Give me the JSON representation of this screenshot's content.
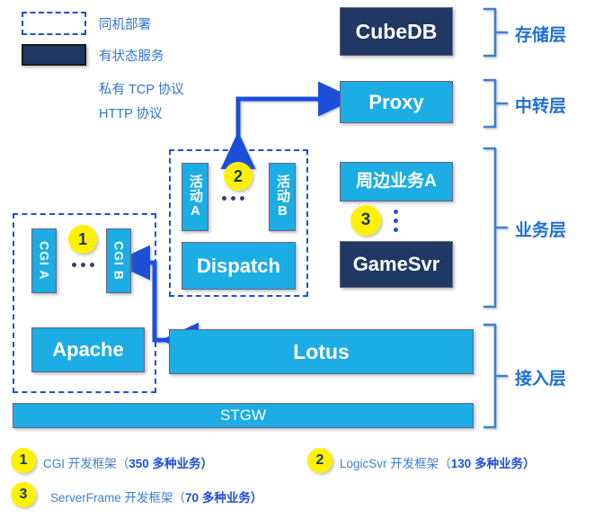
{
  "legend": {
    "items": [
      {
        "icon": "dashed-rect-icon",
        "label": "同机部署"
      },
      {
        "icon": "filled-rect-icon",
        "label": "有状态服务"
      },
      {
        "icon": "blue-double-arrow-icon",
        "label": "私有 TCP 协议"
      },
      {
        "icon": "yellow-double-arrow-icon",
        "label": "HTTP 协议"
      }
    ]
  },
  "nodes": {
    "cubedb": "CubeDB",
    "proxy": "Proxy",
    "peripheral_a": "周边业务A",
    "gamesvr": "GameSvr",
    "activity_a": "活动A",
    "activity_b": "活动B",
    "dispatch": "Dispatch",
    "cgi_a": "CGI A",
    "cgi_b": "CGI B",
    "apache": "Apache",
    "lotus": "Lotus",
    "stgw": "STGW"
  },
  "badges": {
    "one": "1",
    "two": "2",
    "three": "3"
  },
  "layers": [
    {
      "name": "storage",
      "label": "存储层"
    },
    {
      "name": "transit",
      "label": "中转层"
    },
    {
      "name": "business",
      "label": "业务层"
    },
    {
      "name": "access",
      "label": "接入层"
    }
  ],
  "footnotes": [
    {
      "num": "1",
      "name": "CGI",
      "text_pre": "CGI 开发框架（",
      "count": "350",
      "text_post": " 多种业务）"
    },
    {
      "num": "2",
      "name": "LogicSvr",
      "text_pre": "LogicSvr 开发框架（",
      "count": "130",
      "text_post": " 多种业务）"
    },
    {
      "num": "3",
      "name": "ServerFrame",
      "text_pre": "ServerFrame 开发框架（",
      "count": "70",
      "text_post": " 多种业务）"
    }
  ],
  "colors": {
    "light_blue": "#1CADE4",
    "dark_navy": "#1F3864",
    "arrow_blue": "#1F4FD8",
    "arrow_yellow": "#FFF200",
    "label_blue": "#2E75D4",
    "layer_blue": "#1F6FD0"
  }
}
